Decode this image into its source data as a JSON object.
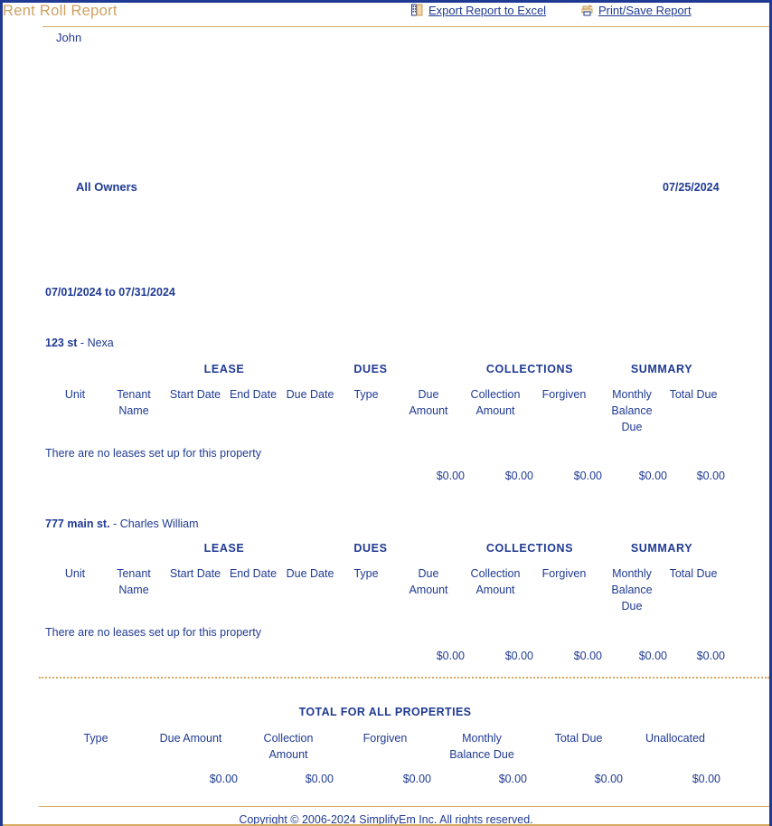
{
  "window": {
    "border_color": "#1f3a93",
    "rule_color": "#d6a960",
    "text_color": "#1f3a93",
    "title_color": "#cfa060"
  },
  "toolbar": {
    "export_label": "Export Report to Excel",
    "export_icon": "excel-spreadsheet-icon",
    "print_label": "Print/Save Report",
    "print_icon": "printer-icon"
  },
  "header": {
    "user_name": "John",
    "report_title": "Rent Roll Report",
    "owner_scope": "All Owners",
    "report_date": "07/25/2024",
    "date_range": "07/01/2024 to 07/31/2024"
  },
  "group_headers": {
    "lease": "LEASE",
    "dues": "DUES",
    "collections": "COLLECTIONS",
    "summary": "SUMMARY"
  },
  "column_headers": {
    "unit": "Unit",
    "tenant_name": "Tenant Name",
    "start_date": "Start Date",
    "end_date": "End Date",
    "due_date": "Due Date",
    "type": "Type",
    "due_amount": "Due Amount",
    "collection_amount": "Collection Amount",
    "forgiven": "Forgiven",
    "monthly_balance_due": "Monthly Balance Due",
    "total_due": "Total Due"
  },
  "properties": [
    {
      "address": "123 st",
      "owner_separator": " - ",
      "owner": "Nexa",
      "empty_message": "There are no leases set up for this property",
      "totals": [
        "$0.00",
        "$0.00",
        "$0.00",
        "$0.00",
        "$0.00"
      ]
    },
    {
      "address": "777 main st.",
      "owner_separator": " - ",
      "owner": "Charles William",
      "empty_message": "There are no leases set up for this property",
      "totals": [
        "$0.00",
        "$0.00",
        "$0.00",
        "$0.00",
        "$0.00"
      ]
    }
  ],
  "grand_totals": {
    "title": "TOTAL FOR ALL PROPERTIES",
    "columns": [
      "Type",
      "Due Amount",
      "Collection Amount",
      "Forgiven",
      "Monthly Balance Due",
      "Total Due",
      "Unallocated"
    ],
    "values": [
      "$0.00",
      "$0.00",
      "$0.00",
      "$0.00",
      "$0.00",
      "$0.00"
    ]
  },
  "footer": {
    "copyright": "Copyright © 2006-2024 SimplifyEm Inc. All rights reserved."
  }
}
